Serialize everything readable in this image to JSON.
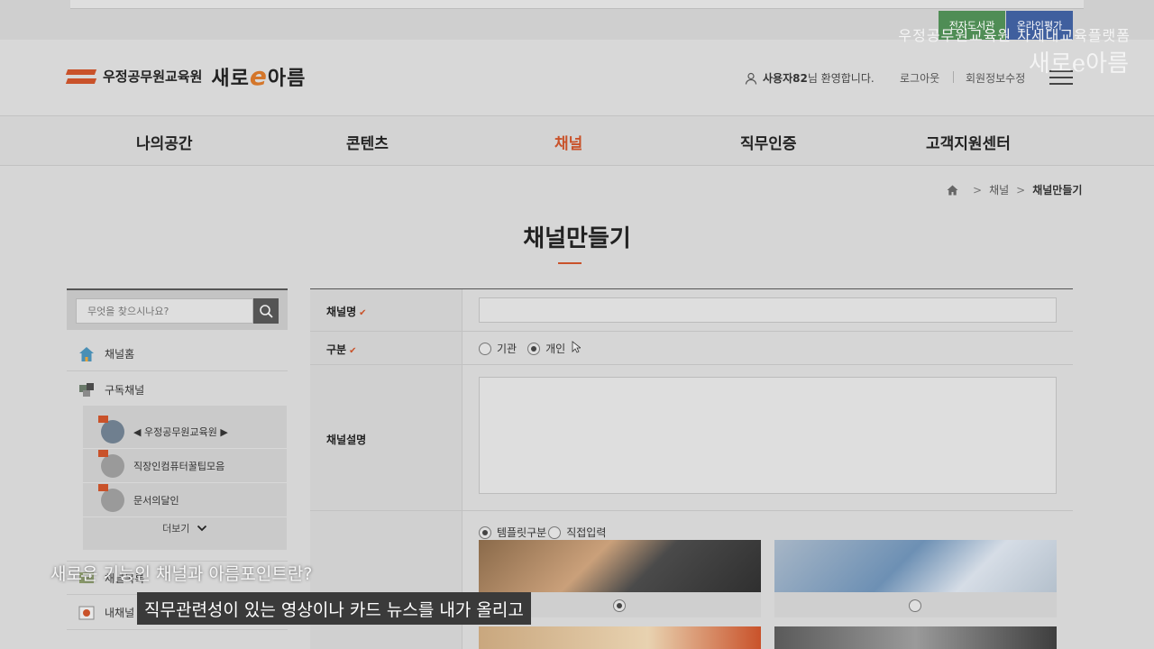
{
  "quick_links": {
    "library": "전자도서관",
    "online_eval": "온라인평가"
  },
  "watermark": {
    "title": "우정공무원교육원 차세대교육플랫폼",
    "brand": "새로e아름"
  },
  "header": {
    "org_name": "우정공무원교육원",
    "brand_pre": "새로",
    "brand_e": "e",
    "brand_post": "아름",
    "user_name": "사용자82",
    "user_suffix": "님 환영합니다.",
    "logout": "로그아웃",
    "member_edit": "회원정보수정"
  },
  "gnb": {
    "items": [
      {
        "label": "나의공간"
      },
      {
        "label": "콘텐츠"
      },
      {
        "label": "채널"
      },
      {
        "label": "직무인증"
      },
      {
        "label": "고객지원센터"
      }
    ],
    "active_index": 2
  },
  "breadcrumb": {
    "items": [
      "채널",
      "채널만들기"
    ],
    "arrow": ">"
  },
  "page": {
    "title": "채널만들기"
  },
  "sidebar": {
    "search_placeholder": "무엇을 찾으시나요?",
    "menu": [
      {
        "label": "채널홈",
        "icon": "home-icon"
      },
      {
        "label": "구독채널",
        "icon": "puzzle-icon"
      },
      {
        "label": "채널목록",
        "icon": "list-icon"
      },
      {
        "label": "내채널",
        "icon": "flag-icon"
      }
    ],
    "subscribed": [
      {
        "label": "◀ 우정공무원교육원 ▶"
      },
      {
        "label": "직장인컴퓨터꿀팁모음"
      },
      {
        "label": "문서의달인"
      }
    ],
    "more_label": "더보기"
  },
  "form": {
    "channel_name_label": "채널명",
    "type_label": "구분",
    "type_options": [
      "기관",
      "개인"
    ],
    "type_selected": "개인",
    "desc_label": "채널설명",
    "template_options": [
      "템플릿구분",
      "직접입력"
    ],
    "template_selected": "템플릿구분",
    "required_mark": "✔"
  },
  "subtitles": {
    "line1": "새로운 기능인 채널과 아름포인트란?",
    "line2": "직무관련성이 있는 영상이나 카드 뉴스를 내가 올리고"
  },
  "colors": {
    "accent": "#c9522a",
    "green": "#4f8d55",
    "blue": "#3f5f9e"
  }
}
